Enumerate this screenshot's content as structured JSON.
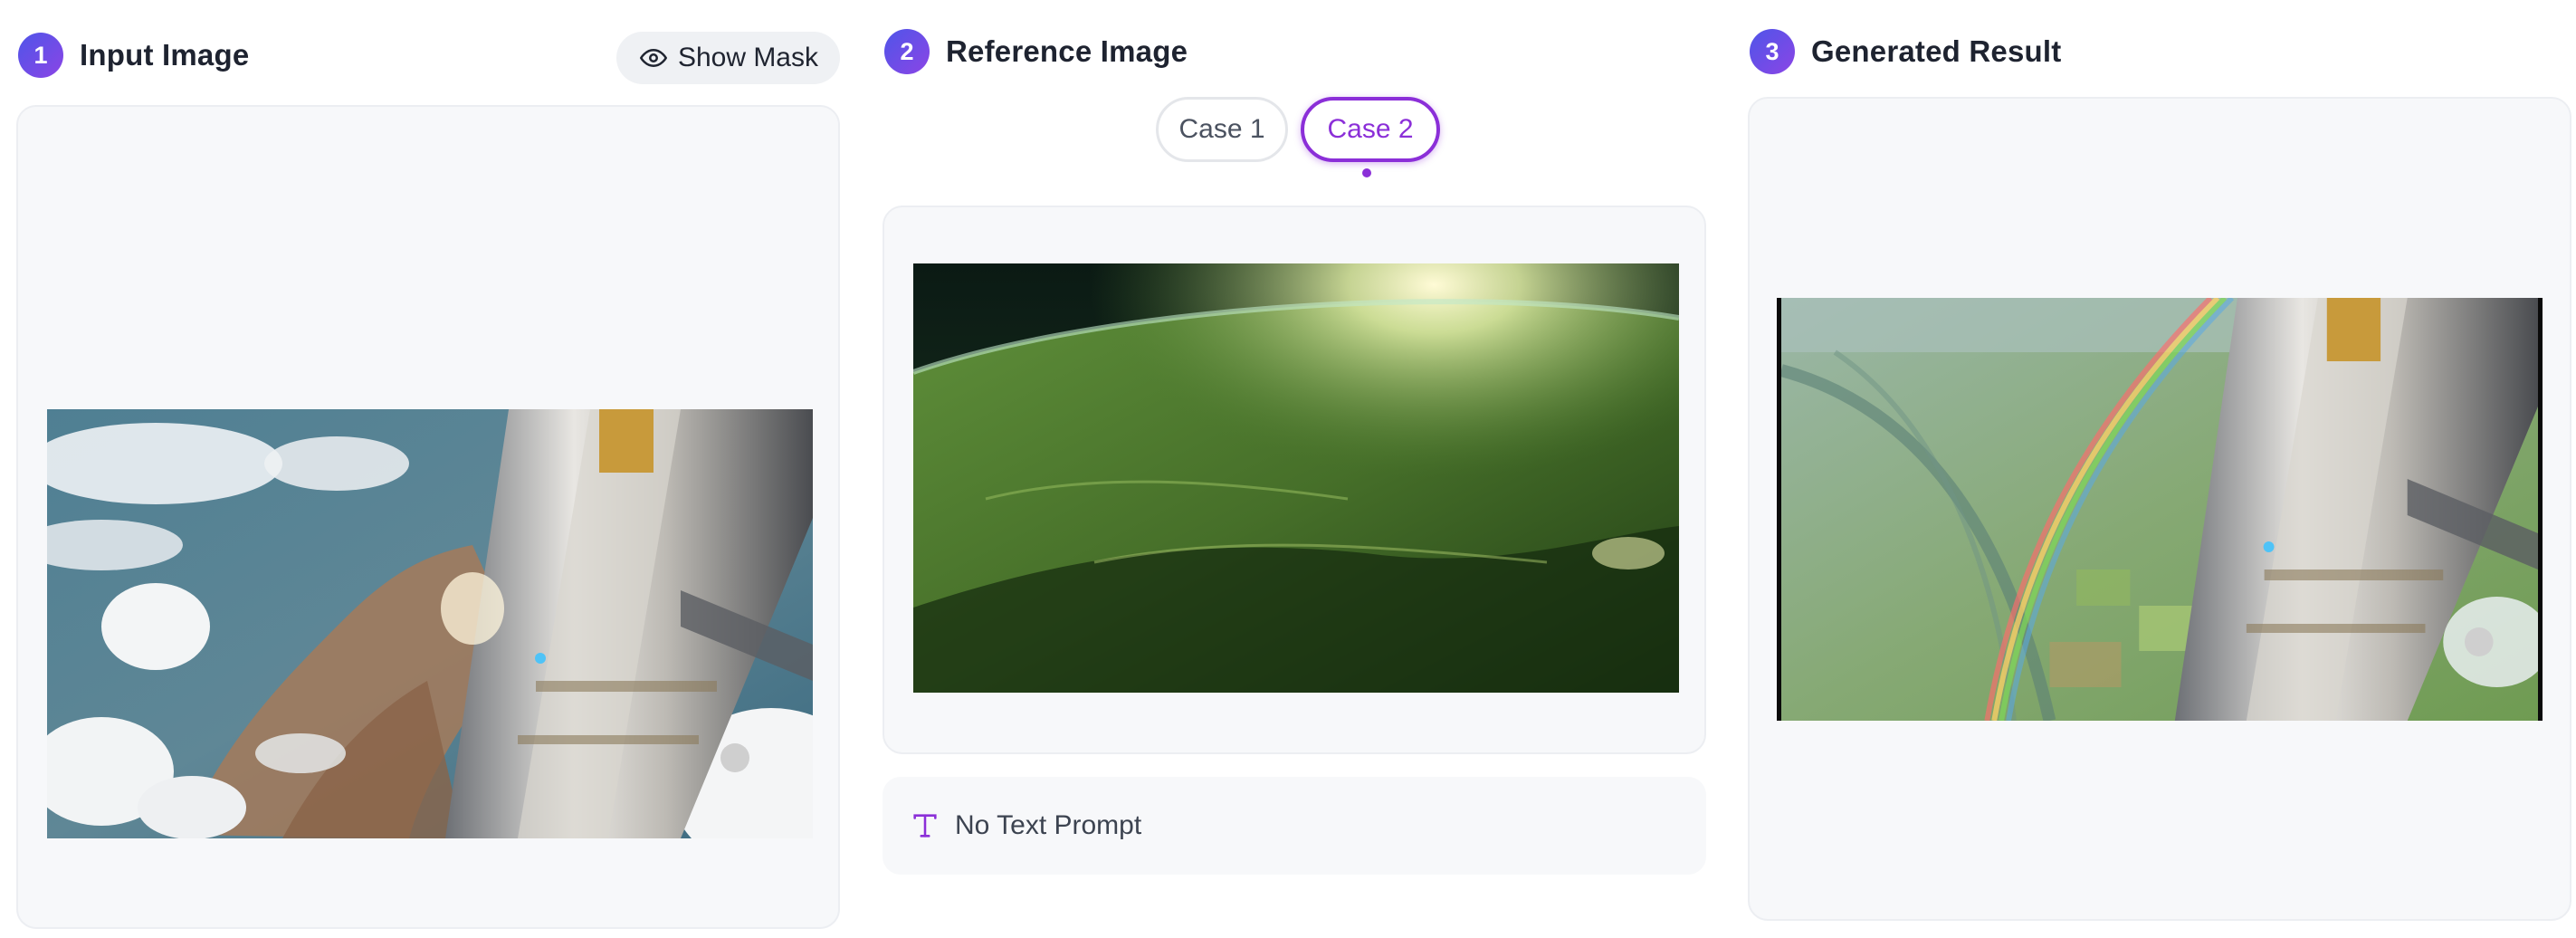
{
  "input_section": {
    "step": "1",
    "title": "Input Image",
    "show_mask_label": "Show Mask",
    "image_icon": "input-earth-space-station-image"
  },
  "reference_section": {
    "step": "2",
    "title": "Reference Image",
    "tabs": [
      {
        "label": "Case 1",
        "selected": false
      },
      {
        "label": "Case 2",
        "selected": true
      }
    ],
    "image_icon": "reference-green-earth-image",
    "prompt_text": "No Text Prompt",
    "prompt_icon": "text-type-icon"
  },
  "result_section": {
    "step": "3",
    "title": "Generated Result",
    "image_icon": "generated-rainbow-landscape-image"
  },
  "colors": {
    "accent": "#8b2fd8",
    "step_gradient_start": "#4f55e8",
    "step_gradient_end": "#8b45e6",
    "panel_bg": "#f7f8fa"
  }
}
